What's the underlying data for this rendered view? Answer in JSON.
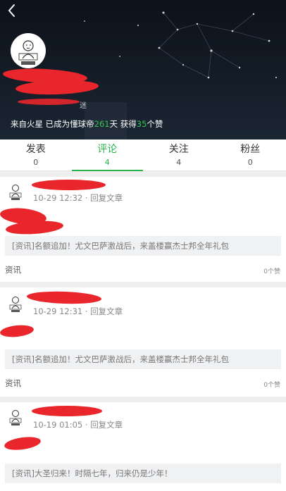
{
  "profile": {
    "bio_prefix": "来自火星 已成为懂球帝",
    "bio_days": "261",
    "bio_mid": "天 获得",
    "bio_likes": "35",
    "bio_suffix": "个赞",
    "partial_line": "迷"
  },
  "tabs": [
    {
      "label": "发表",
      "count": "0"
    },
    {
      "label": "评论",
      "count": "4"
    },
    {
      "label": "关注",
      "count": "4"
    },
    {
      "label": "粉丝",
      "count": "0"
    }
  ],
  "comments": [
    {
      "time": "10-29 12:32",
      "sep": "·",
      "reply": "回复文章",
      "article": "[资讯]名额追加！尤文巴萨激战后，来盖楼赢杰士邦全年礼包",
      "category": "资讯",
      "likes": "0个赞"
    },
    {
      "time": "10-29 12:31",
      "sep": "·",
      "reply": "回复文章",
      "article": "[资讯]名额追加！尤文巴萨激战后，来盖楼赢杰士邦全年礼包",
      "category": "资讯",
      "likes": "0个赞"
    },
    {
      "time": "10-19 01:05",
      "sep": "·",
      "reply": "回复文章",
      "article": "[资讯]大圣归来！时隔七年，归来仍是少年！",
      "category": "",
      "likes": ""
    }
  ],
  "colors": {
    "accent": "#2bb24c",
    "redaction": "#e8262b"
  }
}
